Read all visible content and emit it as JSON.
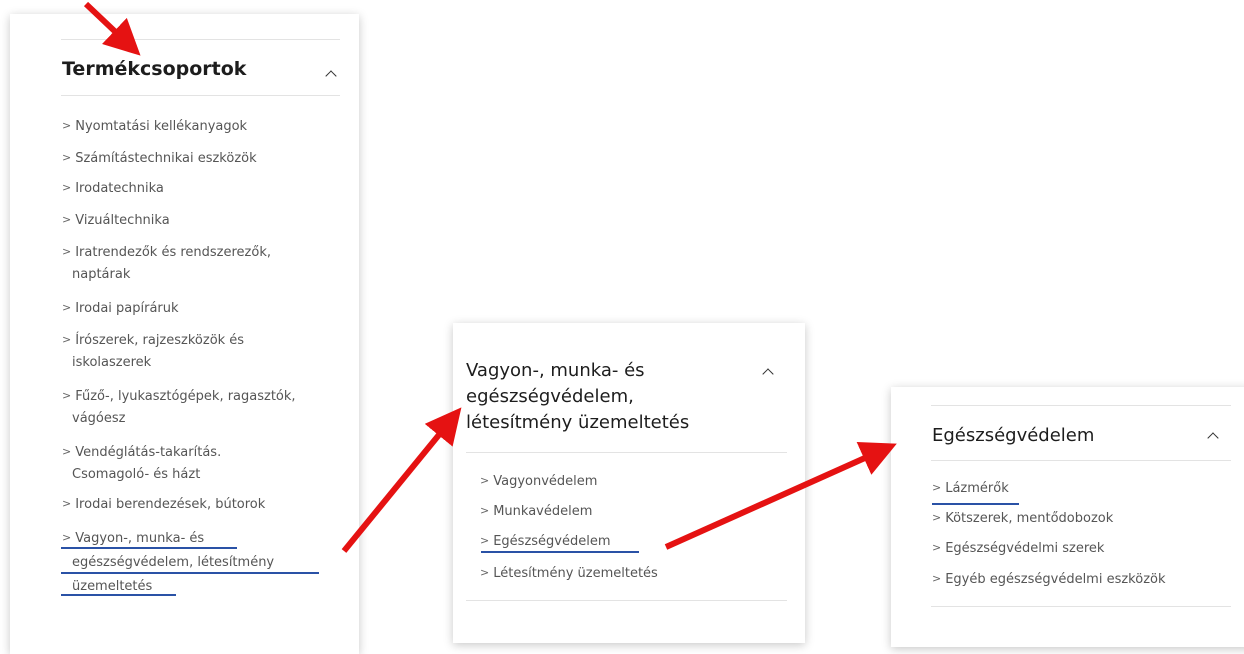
{
  "panel_main": {
    "title": "Termékcsoportok",
    "items": [
      {
        "lines": [
          "Nyomtatási kellékanyagok"
        ]
      },
      {
        "lines": [
          "Számítástechnikai eszközök"
        ]
      },
      {
        "lines": [
          "Irodatechnika"
        ]
      },
      {
        "lines": [
          "Vizuáltechnika"
        ]
      },
      {
        "lines": [
          "Iratrendezők és rendszerezők,",
          "naptárak"
        ]
      },
      {
        "lines": [
          "Irodai papíráruk"
        ]
      },
      {
        "lines": [
          "Írószerek, rajzeszközök és",
          "iskolaszerek"
        ]
      },
      {
        "lines": [
          "Fűző-, lyukasztógépek, ragasztók,",
          "vágóesz"
        ]
      },
      {
        "lines": [
          "Vendéglátás-takarítás.",
          "Csomagoló- és házt"
        ]
      },
      {
        "lines": [
          "Irodai berendezések, bútorok"
        ]
      },
      {
        "lines": [
          "Vagyon-, munka- és",
          "egészségvédelem, létesítmény",
          "üzemeltetés"
        ]
      }
    ]
  },
  "panel_mid": {
    "title_lines": [
      "Vagyon-, munka- és",
      "egészségvédelem,",
      "létesítmény üzemeltetés"
    ],
    "items": [
      "Vagyonvédelem",
      "Munkavédelem",
      "Egészségvédelem",
      "Létesítmény üzemeltetés"
    ]
  },
  "panel_right": {
    "title": "Egészségvédelem",
    "items": [
      "Lázmérők",
      "Kötszerek, mentődobozok",
      "Egészségvédelmi szerek",
      "Egyéb egészségvédelmi eszközök"
    ]
  },
  "colors": {
    "annotation_arrow": "#e51212",
    "annotation_underline": "#2a52a6"
  },
  "icons": {
    "expand_toggle": "chevron-up-icon",
    "item_marker": "chevron-right-icon"
  }
}
